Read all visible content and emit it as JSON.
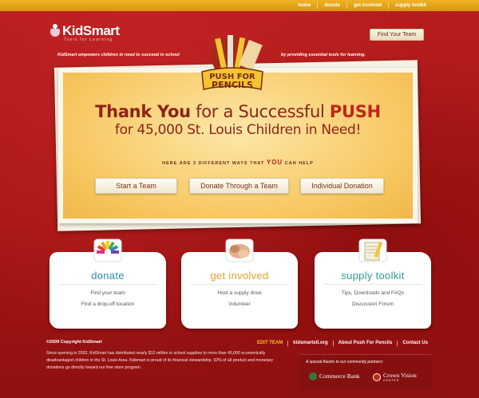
{
  "topnav": [
    {
      "label": "home"
    },
    {
      "label": "donate"
    },
    {
      "label": "get involved"
    },
    {
      "label": "supply toolkit"
    }
  ],
  "header": {
    "logo_text": "KidSmart",
    "logo_tagline": "Tools for Learning",
    "find_team_button": "Find Your Team",
    "tagline_left": "KidSmart empowers children in need to succeed in school",
    "tagline_right": "by providing essential tools for learning."
  },
  "hero": {
    "badge_line1": "PUSH FOR",
    "badge_line2": "PENCILS",
    "headline_1_a": "Thank You",
    "headline_1_b": " for a Successful ",
    "headline_1_c": "PUSH",
    "headline_2": "for 45,000 St. Louis Children in Need!",
    "ways_before": "HERE ARE 3 DIFFERENT WAYS THAT ",
    "ways_you": "YOU",
    "ways_after": " CAN HELP",
    "buttons": [
      {
        "label": "Start a Team"
      },
      {
        "label": "Donate Through a Team"
      },
      {
        "label": "Individual Donation"
      }
    ]
  },
  "cards": [
    {
      "title": "donate",
      "color": "#2a8fb0",
      "links": [
        "Find your team",
        "Find a drop-off location"
      ]
    },
    {
      "title": "get involved",
      "color": "#e8a12a",
      "links": [
        "Host a supply drive",
        "Volunteer"
      ]
    },
    {
      "title": "supply toolkit",
      "color": "#2c9c96",
      "links": [
        "Tips, Downloads and FAQs",
        "Discussion Forum"
      ]
    }
  ],
  "footer": {
    "copyright": "©2009 Copyright KidSmart",
    "about": "Since opening in 2002, KidSmart has distributed nearly $12 million in school supplies to more than 45,000 economically disadvantaged children in the St. Louis Area. Kidsmart is proud of its financial stewardship. 92% of all product and monetary donations go directly toward our free store program.",
    "nav": [
      {
        "label": "EDIT TEAM"
      },
      {
        "label": "kidsmartstl.org"
      },
      {
        "label": "About Push For Pencils"
      },
      {
        "label": "Contact Us"
      }
    ],
    "partners_label": "A special thanks to our community partners:",
    "partner_1": "Commerce Bank",
    "partner_2": "Crown Vision",
    "partner_2_sub": "CENTER"
  },
  "colors": {
    "brand_red": "#b01818",
    "accent_orange": "#f1b323",
    "headline_red": "#8d2319"
  }
}
